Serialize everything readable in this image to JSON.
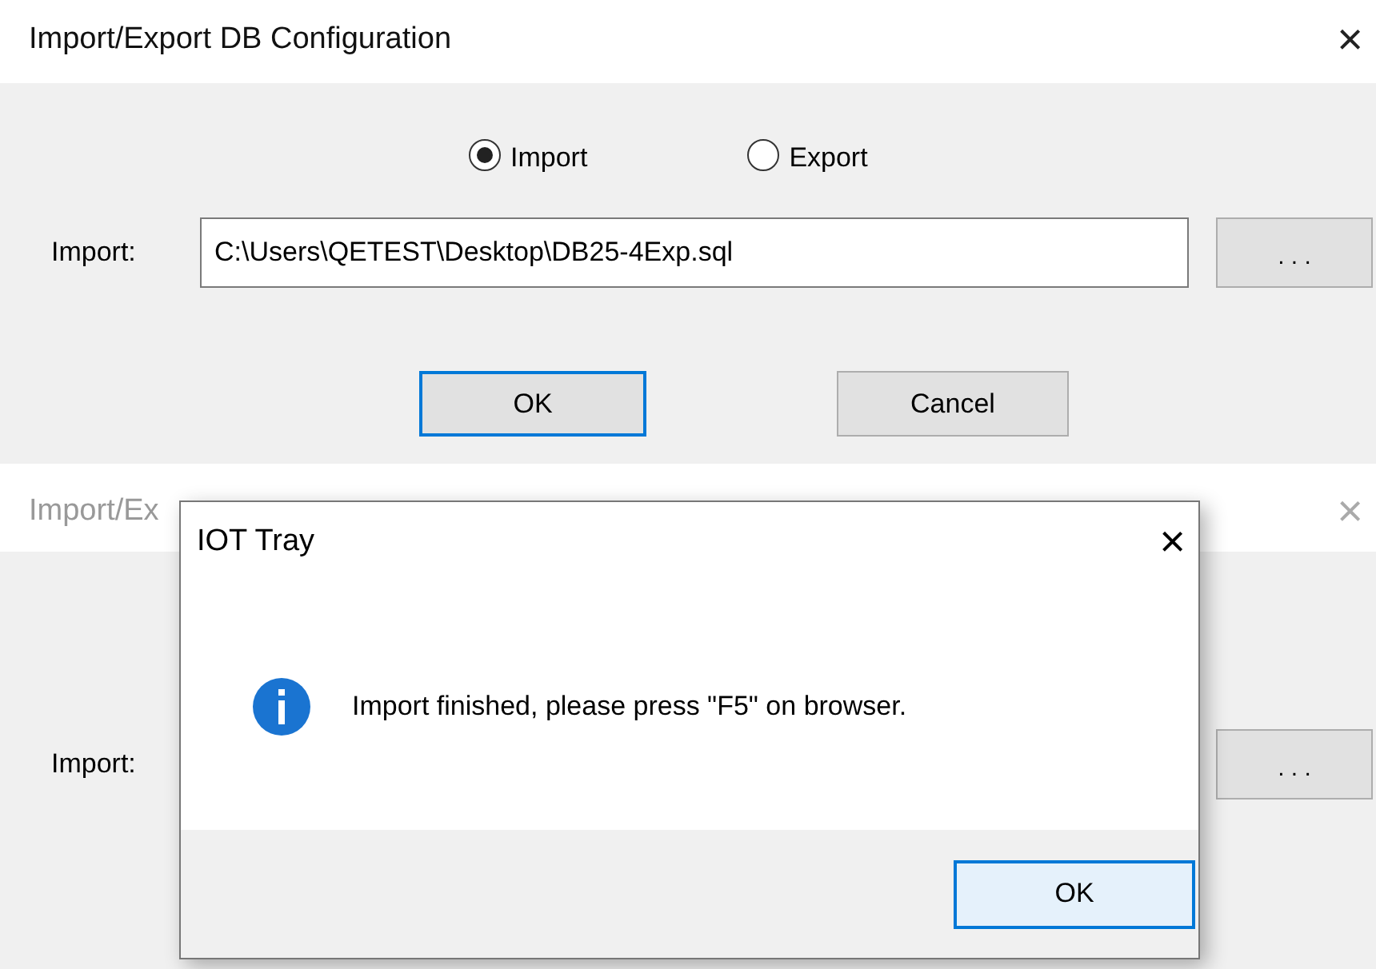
{
  "main_window": {
    "title": "Import/Export DB Configuration",
    "close": "×",
    "modes": [
      {
        "label": "Import",
        "selected": true
      },
      {
        "label": "Export",
        "selected": false
      }
    ],
    "path_label": "Import:",
    "path_value": "C:\\Users\\QETEST\\Desktop\\DB25-4Exp.sql",
    "browse": ". . .",
    "buttons": [
      {
        "label": "OK",
        "default": true
      },
      {
        "label": "Cancel",
        "default": false
      }
    ]
  },
  "back_window": {
    "title": "Import/Ex",
    "close": "×",
    "path_label": "Import:",
    "browse": ". . ."
  },
  "dialog": {
    "title": "IOT Tray",
    "close": "×",
    "message": "Import finished, please press \"F5\" on browser.",
    "button": "OK"
  }
}
